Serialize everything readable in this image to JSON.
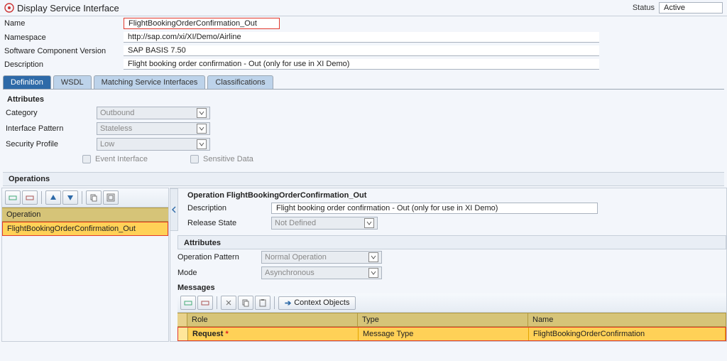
{
  "header": {
    "title": "Display Service Interface",
    "status_label": "Status",
    "status_value": "Active"
  },
  "form": {
    "name_label": "Name",
    "name_value": "FlightBookingOrderConfirmation_Out",
    "namespace_label": "Namespace",
    "namespace_value": "http://sap.com/xi/XI/Demo/Airline",
    "scv_label": "Software Component Version",
    "scv_value": "SAP BASIS 7.50",
    "desc_label": "Description",
    "desc_value": "Flight booking order confirmation - Out (only for use in XI Demo)"
  },
  "tabs": {
    "definition": "Definition",
    "wsdl": "WSDL",
    "matching": "Matching Service Interfaces",
    "classifications": "Classifications"
  },
  "attributes": {
    "title": "Attributes",
    "category_label": "Category",
    "category_value": "Outbound",
    "pattern_label": "Interface Pattern",
    "pattern_value": "Stateless",
    "security_label": "Security Profile",
    "security_value": "Low",
    "event_label": "Event Interface",
    "sensitive_label": "Sensitive Data"
  },
  "operations": {
    "title": "Operations",
    "column_header": "Operation",
    "row1": "FlightBookingOrderConfirmation_Out"
  },
  "op_detail": {
    "title": "Operation FlightBookingOrderConfirmation_Out",
    "desc_label": "Description",
    "desc_value": "Flight booking order confirmation - Out (only for use in XI Demo)",
    "release_label": "Release State",
    "release_value": "Not Defined",
    "attr_title": "Attributes",
    "op_pattern_label": "Operation Pattern",
    "op_pattern_value": "Normal Operation",
    "mode_label": "Mode",
    "mode_value": "Asynchronous"
  },
  "messages": {
    "title": "Messages",
    "context_btn": "Context Objects",
    "col_role": "Role",
    "col_type": "Type",
    "col_name": "Name",
    "row_role": "Request",
    "row_type": "Message Type",
    "row_name": "FlightBookingOrderConfirmation"
  }
}
